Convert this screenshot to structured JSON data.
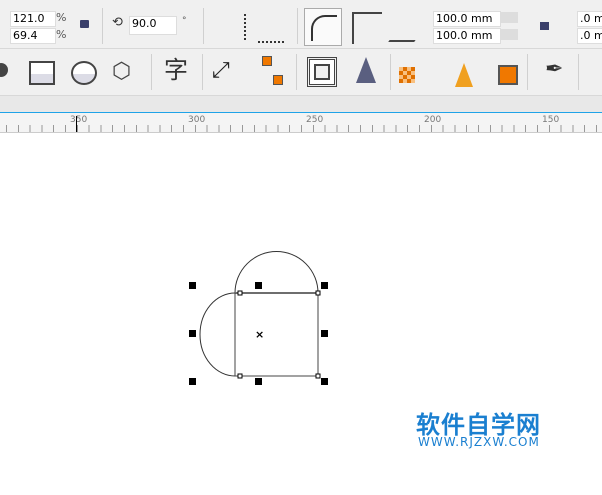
{
  "property_bar": {
    "scale_x": "121.0",
    "scale_y": "69.4",
    "percent_unit": "%",
    "rotation": "90.0",
    "degree_unit": "°",
    "corner_size_1": "100.0 mm",
    "corner_size_2": "100.0 mm",
    "offset_1": ".0 m",
    "offset_2": ".0 m"
  },
  "toolbox_icons": [
    "spiral-icon",
    "rectangle-icon",
    "ellipse-icon",
    "polygon-icon",
    "text-icon",
    "dimension-icon",
    "connector-icon",
    "contour-icon",
    "transparency-icon",
    "color-eyedropper-icon",
    "interactive-fill-icon",
    "smart-fill-icon",
    "pen-outline-icon"
  ],
  "ruler": {
    "labels": [
      "350",
      "300",
      "250",
      "200",
      "150"
    ]
  },
  "watermark": {
    "title": "软件自学网",
    "url": "WWW.RJZXW.COM",
    "color": "#1a7fd0"
  },
  "accent_color": "#1fa3e8"
}
